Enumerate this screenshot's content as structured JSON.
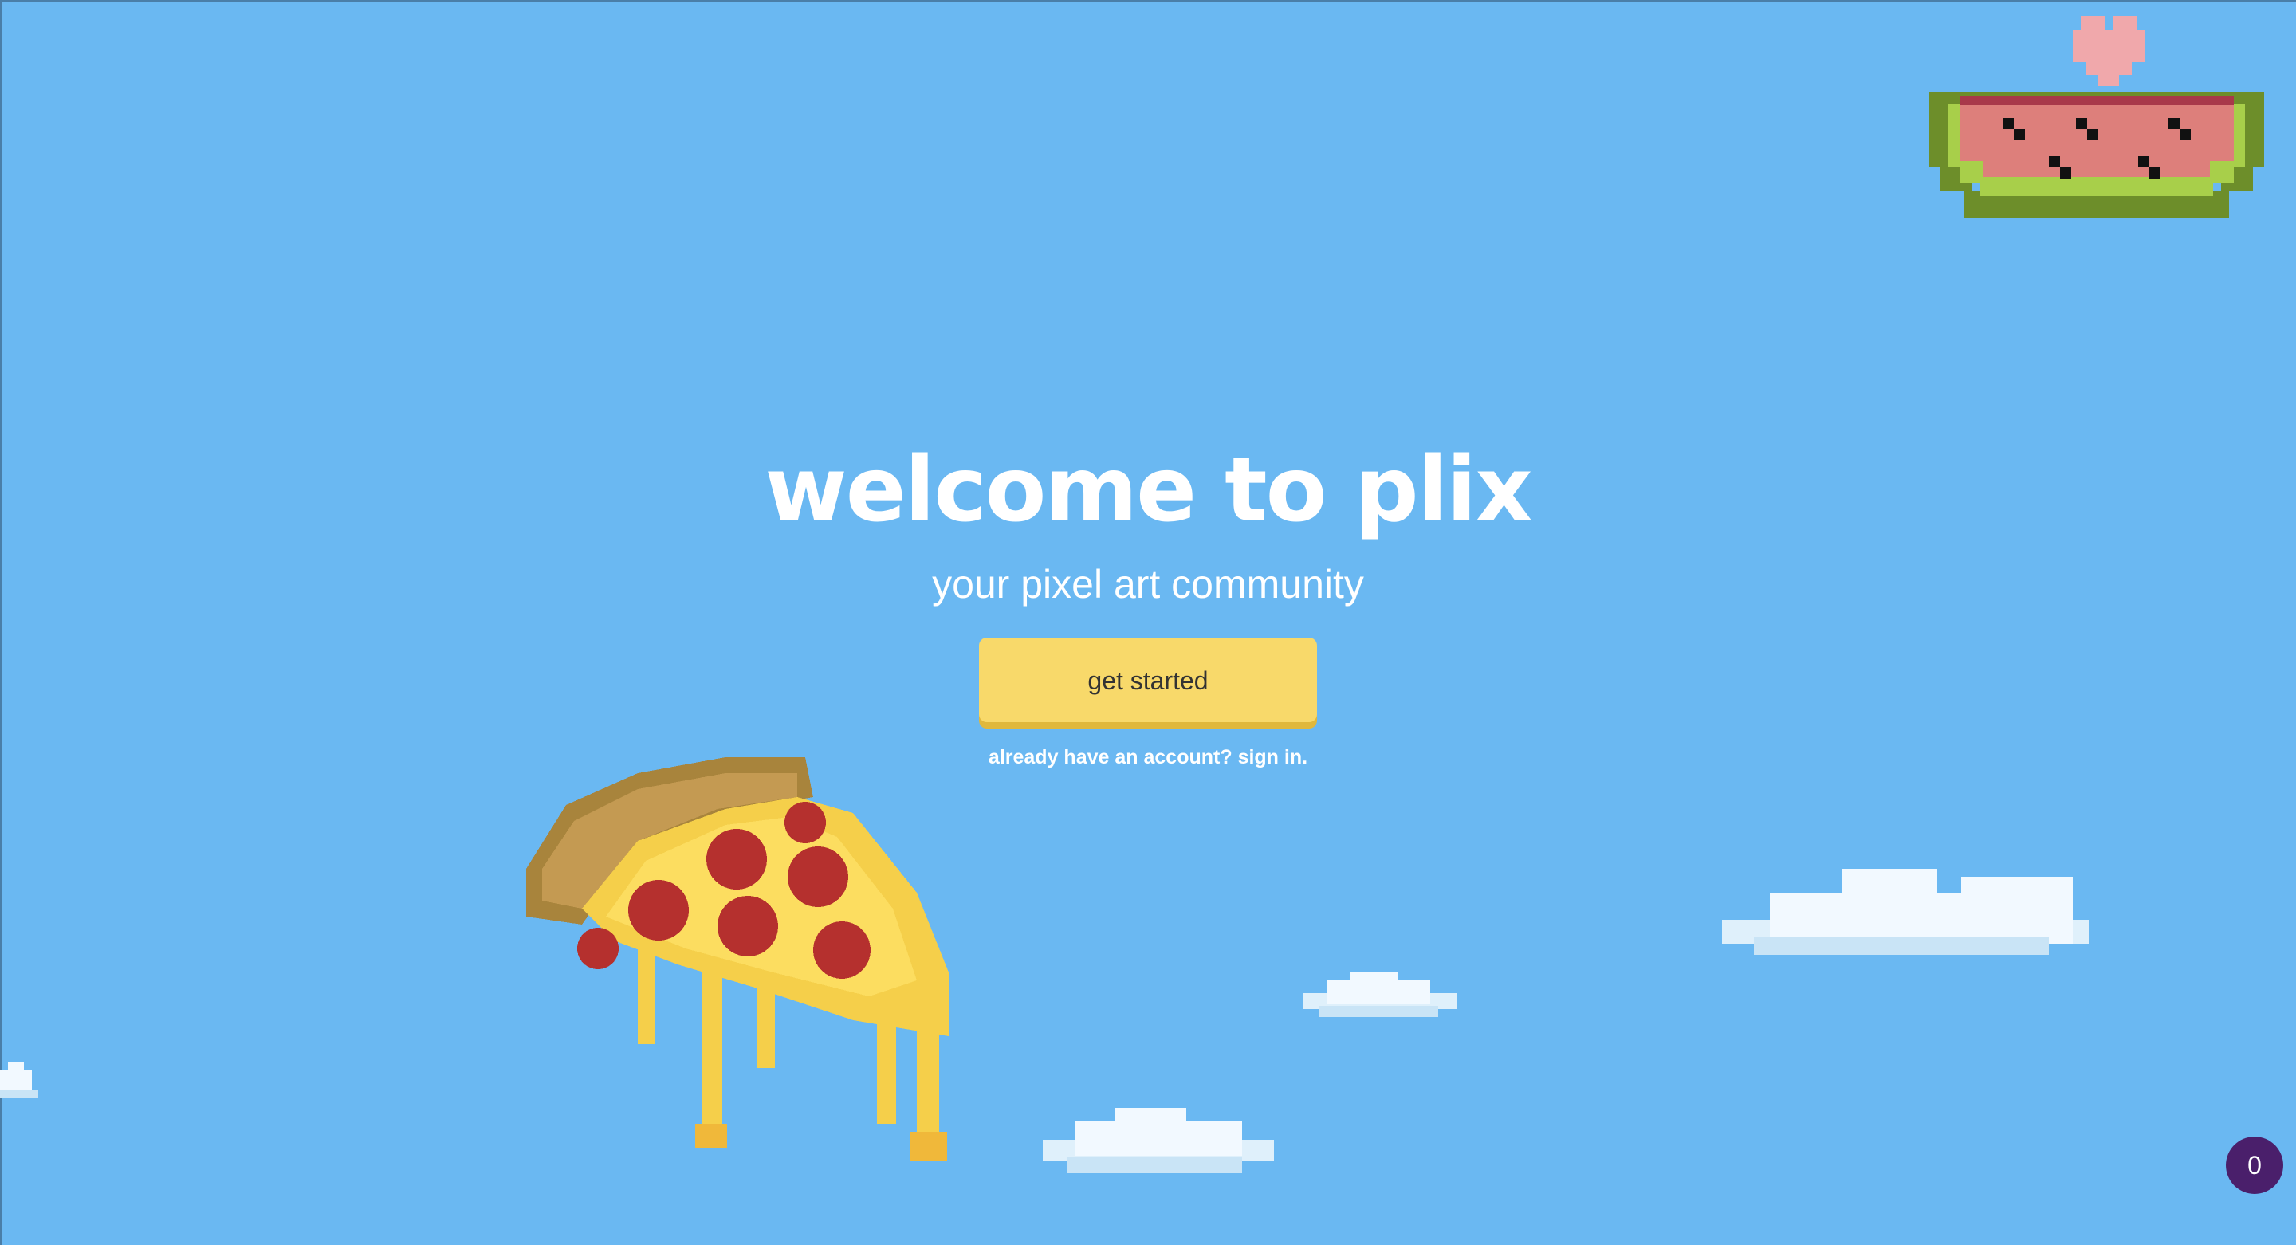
{
  "hero": {
    "title": "welcome to plix",
    "subtitle": "your pixel art community",
    "cta_label": "get started",
    "signin_prompt": "already have an account?",
    "signin_link": "sign in."
  },
  "badge": {
    "count": "0"
  },
  "colors": {
    "sky": "#6ab8f2",
    "cta": "#f8d96a",
    "cta_shadow": "#e0b83c",
    "badge": "#4a1f6b"
  },
  "icons": [
    "watermelon-icon",
    "heart-icon",
    "pizza-slice-icon",
    "cloud-icon"
  ]
}
